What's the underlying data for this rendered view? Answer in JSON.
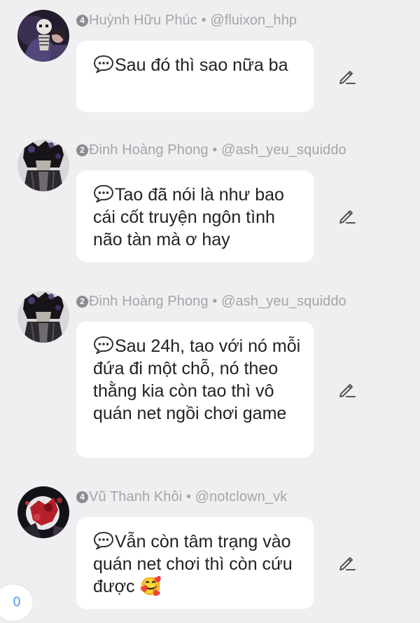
{
  "comments": [
    {
      "rank": "4",
      "name": "Huỳnh Hữu Phúc",
      "separator": "•",
      "handle": "@fluixon_hhp",
      "text": "Sau đó thì sao nữa ba",
      "avatar": "skeleton-character-avatar"
    },
    {
      "rank": "2",
      "name": "Đinh Hoàng Phong",
      "separator": "•",
      "handle": "@ash_yeu_squiddo",
      "text": "Tao đã nói là như bao cái cốt truyện ngôn tình não tàn mà ơ hay",
      "avatar": "dark-hair-character-avatar"
    },
    {
      "rank": "2",
      "name": "Đinh Hoàng Phong",
      "separator": "•",
      "handle": "@ash_yeu_squiddo",
      "text": "Sau 24h, tao với nó mỗi đứa đi một chỗ, nó theo thằng kia còn tao thì vô quán net ngồi chơi game",
      "avatar": "dark-hair-character-avatar"
    },
    {
      "rank": "4",
      "name": "Vũ Thanh Khôi",
      "separator": "•",
      "handle": "@notclown_vk",
      "text": "Vẫn còn tâm trạng vào quán net chơi thì còn cứu được",
      "emoji": "🥰",
      "avatar": "red-splatter-character-avatar"
    }
  ],
  "counter": {
    "value": "0"
  },
  "icons": {
    "speech": "speech-balloon-icon",
    "edit": "pencil-edit-icon"
  },
  "colors": {
    "background": "#efeff1",
    "meta_text": "#a5a5a9",
    "bubble": "#ffffff",
    "body_text": "#222226",
    "counter_text": "#4a90e2"
  }
}
